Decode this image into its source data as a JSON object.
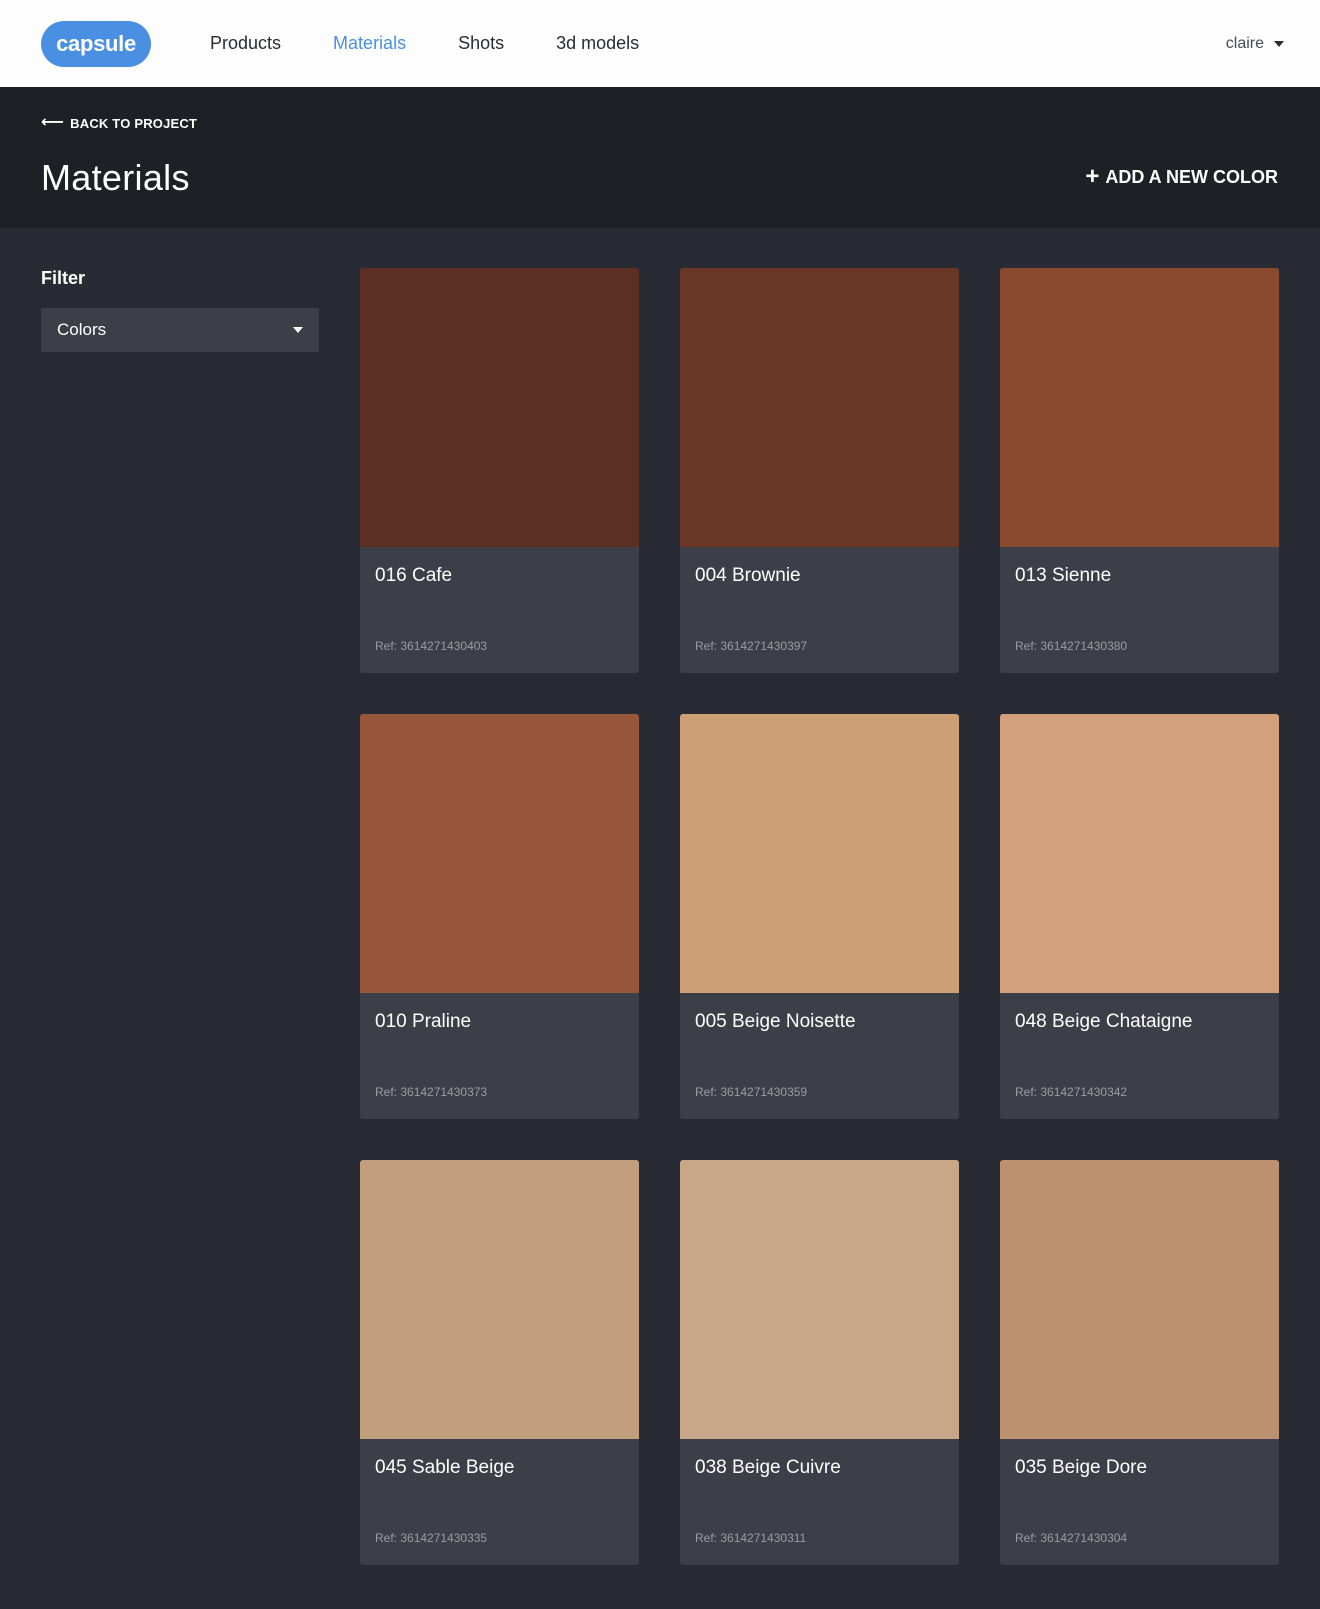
{
  "topbar": {
    "logo_text": "capsule",
    "nav": [
      {
        "label": "Products",
        "active": false
      },
      {
        "label": "Materials",
        "active": true
      },
      {
        "label": "Shots",
        "active": false
      },
      {
        "label": "3d models",
        "active": false
      }
    ],
    "user": "claire"
  },
  "header": {
    "back_label": "BACK TO PROJECT",
    "title": "Materials",
    "add_label": "ADD A NEW COLOR"
  },
  "filter": {
    "label": "Filter",
    "selected": "Colors"
  },
  "materials": [
    {
      "name": "016 Cafe",
      "ref": "Ref: 3614271430403",
      "color": "#5c2f23"
    },
    {
      "name": "004 Brownie",
      "ref": "Ref: 3614271430397",
      "color": "#6a3626"
    },
    {
      "name": "013 Sienne",
      "ref": "Ref: 3614271430380",
      "color": "#8a4a2f"
    },
    {
      "name": "010 Praline",
      "ref": "Ref: 3614271430373",
      "color": "#97553a"
    },
    {
      "name": "005 Beige Noisette",
      "ref": "Ref: 3614271430359",
      "color": "#cc9f77"
    },
    {
      "name": "048 Beige Chataigne",
      "ref": "Ref: 3614271430342",
      "color": "#d4a07b"
    },
    {
      "name": "045 Sable Beige",
      "ref": "Ref: 3614271430335",
      "color": "#c19f7c"
    },
    {
      "name": "038 Beige Cuivre",
      "ref": "Ref: 3614271430311",
      "color": "#c8a688"
    },
    {
      "name": "035 Beige Dore",
      "ref": "Ref: 3614271430304",
      "color": "#bc916f"
    }
  ]
}
